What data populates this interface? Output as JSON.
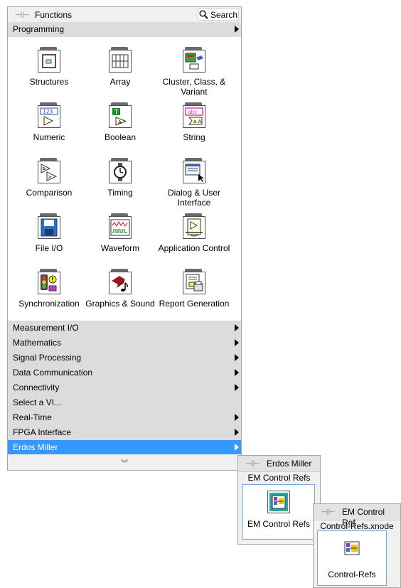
{
  "palette": {
    "title": "Functions",
    "search_label": "Search",
    "top_category": "Programming",
    "items": [
      {
        "label": "Structures",
        "icon": "structures-icon"
      },
      {
        "label": "Array",
        "icon": "array-icon"
      },
      {
        "label": "Cluster, Class, & Variant",
        "icon": "cluster-icon"
      },
      {
        "label": "Numeric",
        "icon": "numeric-icon"
      },
      {
        "label": "Boolean",
        "icon": "boolean-icon"
      },
      {
        "label": "String",
        "icon": "string-icon"
      },
      {
        "label": "Comparison",
        "icon": "comparison-icon"
      },
      {
        "label": "Timing",
        "icon": "timing-icon"
      },
      {
        "label": "Dialog & User Interface",
        "icon": "dialog-icon"
      },
      {
        "label": "File I/O",
        "icon": "file-io-icon"
      },
      {
        "label": "Waveform",
        "icon": "waveform-icon"
      },
      {
        "label": "Application Control",
        "icon": "application-control-icon"
      },
      {
        "label": "Synchronization",
        "icon": "synchronization-icon"
      },
      {
        "label": "Graphics & Sound",
        "icon": "graphics-sound-icon"
      },
      {
        "label": "Report Generation",
        "icon": "report-generation-icon"
      }
    ],
    "categories": [
      {
        "label": "Measurement I/O",
        "submenu": true
      },
      {
        "label": "Mathematics",
        "submenu": true
      },
      {
        "label": "Signal Processing",
        "submenu": true
      },
      {
        "label": "Data Communication",
        "submenu": true
      },
      {
        "label": "Connectivity",
        "submenu": true
      },
      {
        "label": "Select a VI...",
        "submenu": false
      },
      {
        "label": "Real-Time",
        "submenu": true
      },
      {
        "label": "FPGA Interface",
        "submenu": true
      },
      {
        "label": "Erdos Miller",
        "submenu": true,
        "selected": true
      }
    ],
    "expand_glyph": "»"
  },
  "sub1": {
    "title": "Erdos Miller",
    "heading": "EM Control Refs",
    "item_label": "EM Control Refs"
  },
  "sub2": {
    "title": "EM Control Ref",
    "heading": "Control-Refs.xnode",
    "item_label": "Control-Refs"
  },
  "colors": {
    "selection": "#3399ff",
    "category_bg": "#dcdcdc",
    "panel_bg": "#f0f0f0"
  }
}
